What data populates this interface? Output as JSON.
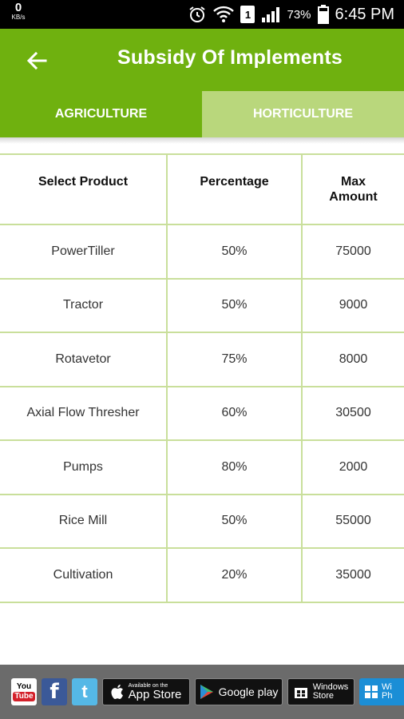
{
  "status_bar": {
    "speed_value": "0",
    "speed_unit": "KB/s",
    "sim_slot": "1",
    "battery_percent": "73%",
    "time": "6:45 PM",
    "icons": [
      "alarm-icon",
      "wifi-icon",
      "signal-icon",
      "battery-icon"
    ]
  },
  "app_bar": {
    "title": "Subsidy Of Implements",
    "back_icon": "arrow-left-icon",
    "background": "#6fb10f"
  },
  "tabs": [
    {
      "label": "AGRICULTURE",
      "selected": true
    },
    {
      "label": "HORTICULTURE",
      "selected": false
    }
  ],
  "table": {
    "headers": [
      "Select Product",
      "Percentage",
      "Max Amount"
    ],
    "rows": [
      {
        "product": "PowerTiller",
        "percentage": "50%",
        "max_amount": "75000"
      },
      {
        "product": "Tractor",
        "percentage": "50%",
        "max_amount": "9000"
      },
      {
        "product": "Rotavetor",
        "percentage": "75%",
        "max_amount": "8000"
      },
      {
        "product": "Axial Flow Thresher",
        "percentage": "60%",
        "max_amount": "30500"
      },
      {
        "product": "Pumps",
        "percentage": "80%",
        "max_amount": "2000"
      },
      {
        "product": "Rice Mill",
        "percentage": "50%",
        "max_amount": "55000"
      },
      {
        "product": "Cultivation",
        "percentage": "20%",
        "max_amount": "35000"
      }
    ]
  },
  "banner": {
    "youtube": {
      "top": "You",
      "bottom": "Tube"
    },
    "facebook": "f",
    "twitter": "t",
    "app_store": {
      "small": "Available on the",
      "big": "App Store"
    },
    "google_play": "Google play",
    "windows_store": {
      "line1": "Windows",
      "line2": "Store"
    },
    "windows_phone": {
      "line1": "Wi",
      "line2": "Ph"
    }
  },
  "colors": {
    "primary_green": "#6fb10f",
    "inactive_tab": "#b9d77c",
    "grid_line": "#c9df9b"
  }
}
